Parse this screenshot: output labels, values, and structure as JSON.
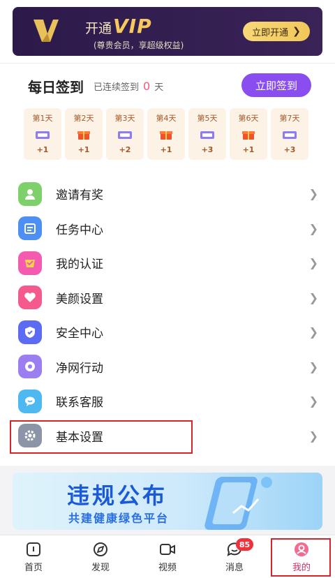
{
  "vip": {
    "open_label": "开通",
    "vip_label": "VIP",
    "subtitle": "(尊贵会员，享超级权益)",
    "button_label": "立即开通"
  },
  "signin": {
    "title": "每日签到",
    "streak_prefix": "已连续签到",
    "streak_days": "0",
    "streak_unit": "天",
    "button_label": "立即签到",
    "days": [
      {
        "label": "第1天",
        "reward": "+1",
        "icon": "coupon-icon"
      },
      {
        "label": "第2天",
        "reward": "+1",
        "icon": "gift-box-icon"
      },
      {
        "label": "第3天",
        "reward": "+2",
        "icon": "coupon-icon"
      },
      {
        "label": "第4天",
        "reward": "+1",
        "icon": "gift-box-icon"
      },
      {
        "label": "第5天",
        "reward": "+3",
        "icon": "coupon-icon"
      },
      {
        "label": "第6天",
        "reward": "+1",
        "icon": "gift-box-icon"
      },
      {
        "label": "第7天",
        "reward": "+3",
        "icon": "coupon-icon"
      }
    ]
  },
  "menu": [
    {
      "label": "邀请有奖",
      "icon": "invite-user-icon",
      "color": "#7dd06a"
    },
    {
      "label": "任务中心",
      "icon": "task-calendar-icon",
      "color": "#4d8ff2"
    },
    {
      "label": "我的认证",
      "icon": "verify-badge-icon",
      "color": "#f45ab0"
    },
    {
      "label": "美颜设置",
      "icon": "heart-icon",
      "color": "#f45b8c"
    },
    {
      "label": "安全中心",
      "icon": "shield-icon",
      "color": "#5b6cf2"
    },
    {
      "label": "净网行动",
      "icon": "eye-icon",
      "color": "#9b7ef0"
    },
    {
      "label": "联系客服",
      "icon": "chat-bubble-icon",
      "color": "#4db9f0"
    },
    {
      "label": "基本设置",
      "icon": "gear-icon",
      "color": "#8c95a8"
    }
  ],
  "banner": {
    "title": "违规公布",
    "subtitle": "共建健康绿色平台"
  },
  "tabs": [
    {
      "label": "首页",
      "icon": "home-icon"
    },
    {
      "label": "发现",
      "icon": "compass-icon"
    },
    {
      "label": "视频",
      "icon": "video-camera-icon"
    },
    {
      "label": "消息",
      "icon": "message-icon",
      "badge": "85"
    },
    {
      "label": "我的",
      "icon": "profile-icon",
      "active": true
    }
  ],
  "colors": {
    "accent_purple": "#8a4ef0",
    "active_tab": "#d22f6a",
    "highlight_box": "#d9222a",
    "streak_number": "#ff5577"
  }
}
